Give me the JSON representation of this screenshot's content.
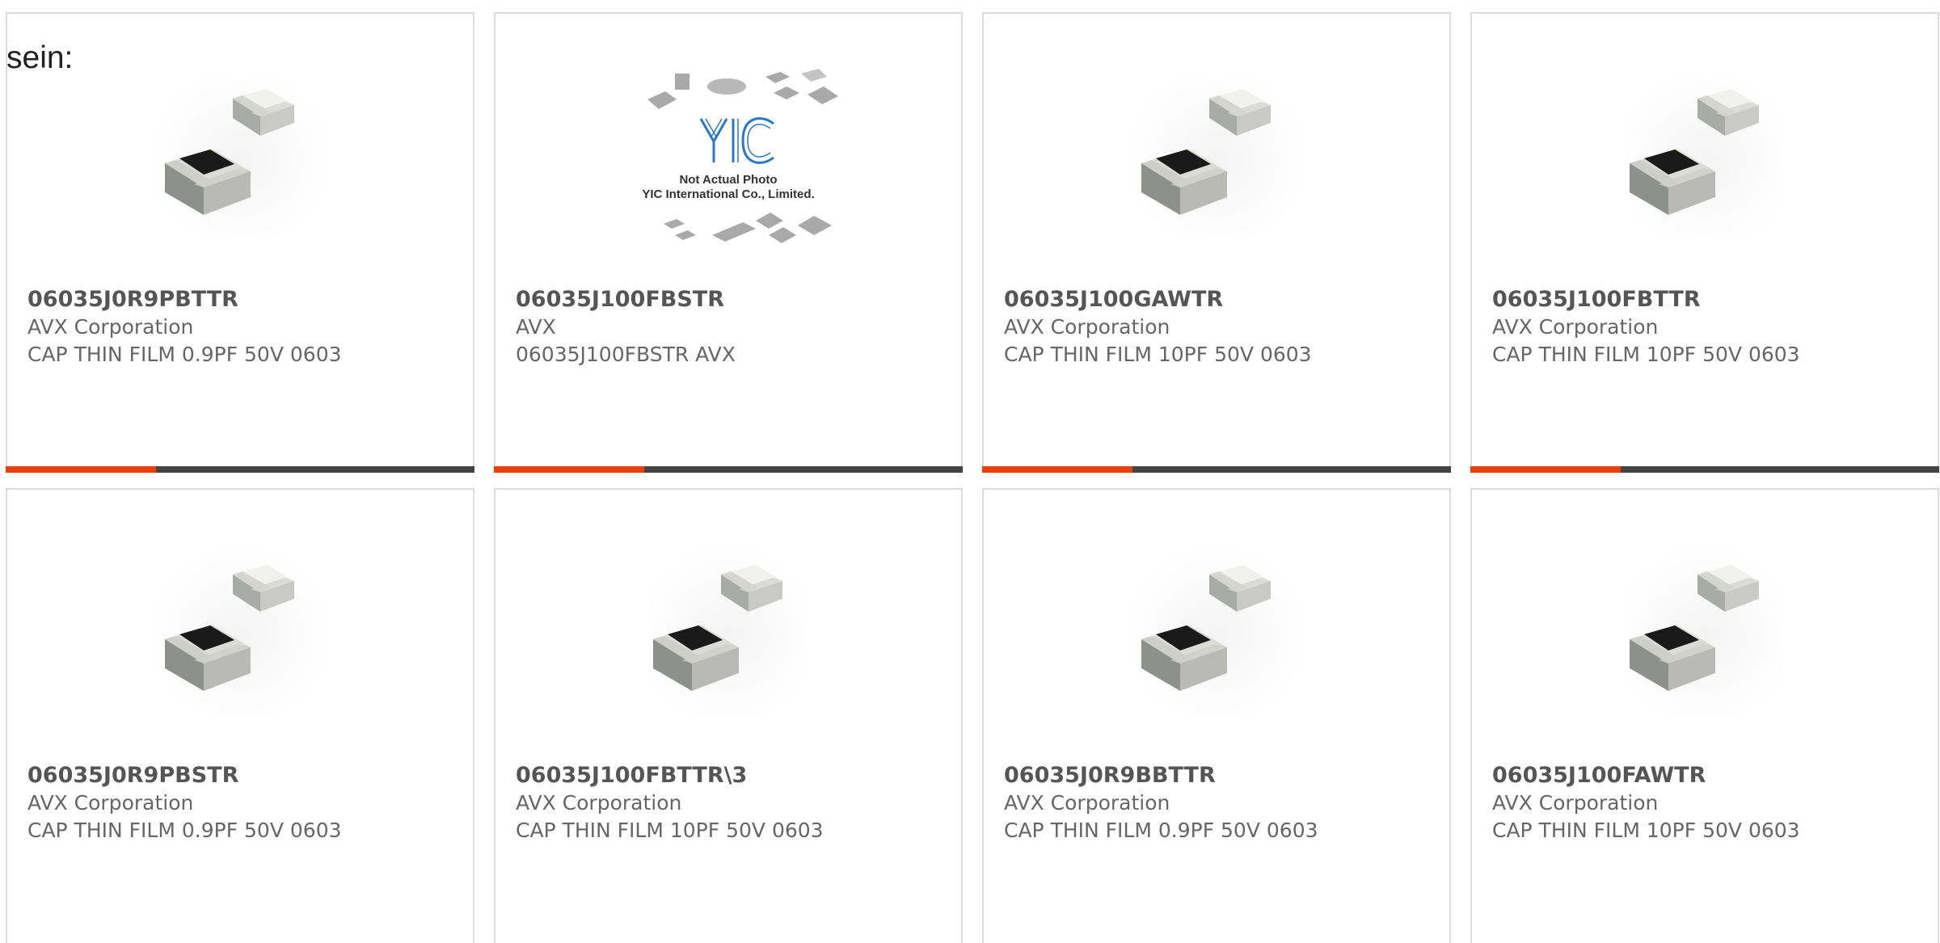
{
  "intro": "sein:",
  "colors": {
    "accent": "#e8400c",
    "track": "#444444",
    "border": "#dcdcdc"
  },
  "products": [
    {
      "part": "06035J0R9PBTTR",
      "maker": "AVX Corporation",
      "desc": "CAP THIN FILM 0.9PF 50V 0603",
      "image": "capacitor-chip-icon",
      "progress": 0.32
    },
    {
      "part": "06035J100FBSTR",
      "maker": "AVX",
      "desc": "06035J100FBSTR AVX",
      "image": "yic-placeholder-icon",
      "progress": 0.32,
      "placeholder": {
        "logo": "YIC",
        "line1": "Not Actual Photo",
        "line2": "YIC International Co., Limited."
      }
    },
    {
      "part": "06035J100GAWTR",
      "maker": "AVX Corporation",
      "desc": "CAP THIN FILM 10PF 50V 0603",
      "image": "capacitor-chip-icon",
      "progress": 0.32
    },
    {
      "part": "06035J100FBTTR",
      "maker": "AVX Corporation",
      "desc": "CAP THIN FILM 10PF 50V 0603",
      "image": "capacitor-chip-icon",
      "progress": 0.32
    },
    {
      "part": "06035J0R9PBSTR",
      "maker": "AVX Corporation",
      "desc": "CAP THIN FILM 0.9PF 50V 0603",
      "image": "capacitor-chip-icon"
    },
    {
      "part": "06035J100FBTTR\\3",
      "maker": "AVX Corporation",
      "desc": "CAP THIN FILM 10PF 50V 0603",
      "image": "capacitor-chip-icon"
    },
    {
      "part": "06035J0R9BBTTR",
      "maker": "AVX Corporation",
      "desc": "CAP THIN FILM 0.9PF 50V 0603",
      "image": "capacitor-chip-icon"
    },
    {
      "part": "06035J100FAWTR",
      "maker": "AVX Corporation",
      "desc": "CAP THIN FILM 10PF 50V 0603",
      "image": "capacitor-chip-icon"
    }
  ]
}
